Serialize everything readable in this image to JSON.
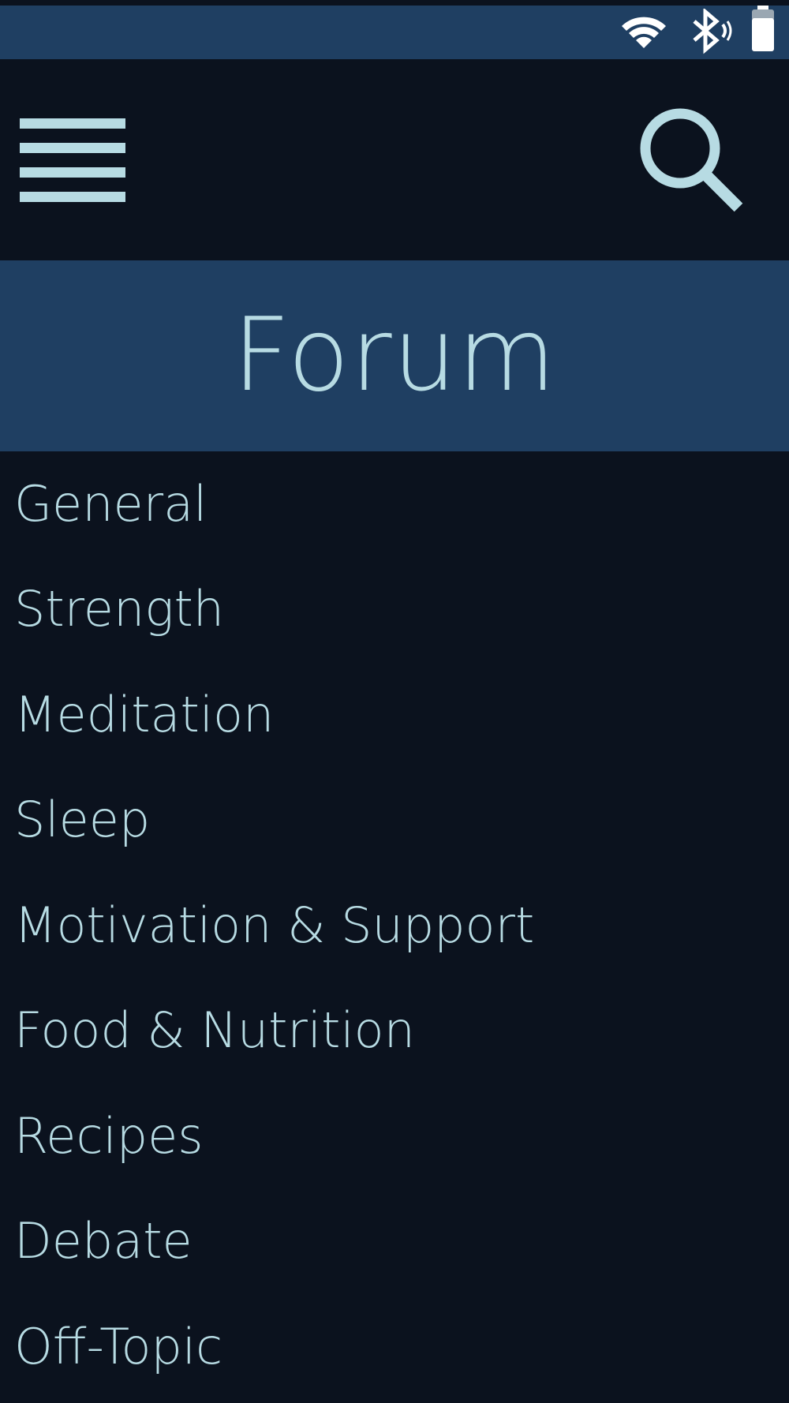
{
  "status_bar": {
    "icons": [
      "wifi-icon",
      "bluetooth-icon",
      "battery-icon"
    ],
    "background": "#1f3f62",
    "icon_color": "#ffffff"
  },
  "toolbar": {
    "menu_icon": "hamburger-menu-icon",
    "search_icon": "search-icon",
    "icon_color": "#b7dbe3"
  },
  "header": {
    "title": "Forum",
    "background": "#1f3f62",
    "text_color": "#b7dbe3"
  },
  "categories": [
    {
      "label": "General"
    },
    {
      "label": "Strength"
    },
    {
      "label": "Meditation"
    },
    {
      "label": "Sleep"
    },
    {
      "label": "Motivation & Support"
    },
    {
      "label": "Food & Nutrition"
    },
    {
      "label": "Recipes"
    },
    {
      "label": "Debate"
    },
    {
      "label": "Off-Topic"
    }
  ],
  "theme": {
    "page_background": "#0b121e",
    "accent": "#1f3f62",
    "text": "#b7dbe3"
  }
}
